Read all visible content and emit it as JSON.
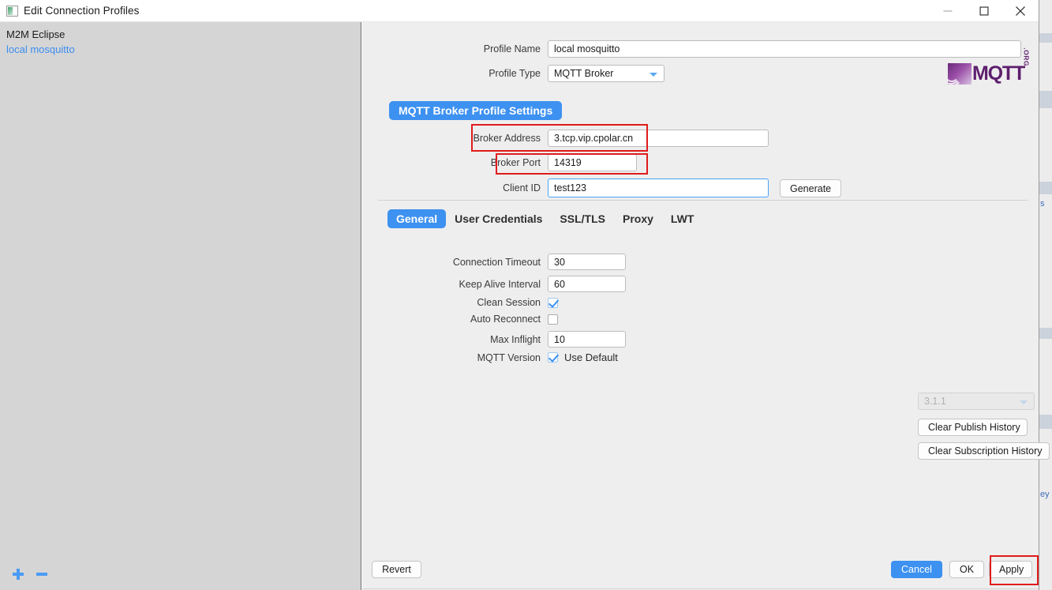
{
  "window": {
    "title": "Edit Connection Profiles",
    "icon": "app-icon",
    "controls": {
      "minimize": "minimize-icon",
      "maximize": "maximize-icon",
      "close": "close-icon"
    }
  },
  "sidebar": {
    "profiles": [
      {
        "label": "M2M Eclipse",
        "selected": false
      },
      {
        "label": "local mosquitto",
        "selected": true
      }
    ],
    "tools": {
      "add": "plus-icon",
      "remove": "minus-icon"
    }
  },
  "form": {
    "profile_name": {
      "label": "Profile Name",
      "value": "local mosquitto"
    },
    "profile_type": {
      "label": "Profile Type",
      "value": "MQTT Broker"
    },
    "section_title": "MQTT Broker Profile Settings",
    "broker_address": {
      "label": "Broker Address",
      "value": "3.tcp.vip.cpolar.cn"
    },
    "broker_port": {
      "label": "Broker Port",
      "value": "14319"
    },
    "client_id": {
      "label": "Client ID",
      "value": "test123"
    },
    "generate_button": "Generate"
  },
  "logo": {
    "word": "MQTT",
    "suffix": ".ORG"
  },
  "tabs": [
    {
      "label": "General",
      "active": true
    },
    {
      "label": "User Credentials",
      "active": false
    },
    {
      "label": "SSL/TLS",
      "active": false
    },
    {
      "label": "Proxy",
      "active": false
    },
    {
      "label": "LWT",
      "active": false
    }
  ],
  "general": {
    "connection_timeout": {
      "label": "Connection Timeout",
      "value": "30"
    },
    "keep_alive_interval": {
      "label": "Keep Alive Interval",
      "value": "60"
    },
    "clean_session": {
      "label": "Clean Session",
      "checked": true
    },
    "auto_reconnect": {
      "label": "Auto Reconnect",
      "checked": false
    },
    "max_inflight": {
      "label": "Max Inflight",
      "value": "10"
    },
    "mqtt_version": {
      "label": "MQTT Version",
      "use_default_label": "Use Default",
      "use_default_checked": true,
      "version_value": "3.1.1"
    },
    "clear_publish_history": "Clear Publish History",
    "clear_subscription_history": "Clear Subscription History"
  },
  "footer": {
    "revert": "Revert",
    "cancel": "Cancel",
    "ok": "OK",
    "apply": "Apply"
  },
  "colors": {
    "accent_blue": "#3d91f0",
    "highlight_red": "#e01b1b",
    "sidebar_bg": "#d5d5d5",
    "panel_bg": "#eeeeee",
    "link_blue": "#3c8ef0",
    "logo_purple": "#5e1f6e"
  }
}
